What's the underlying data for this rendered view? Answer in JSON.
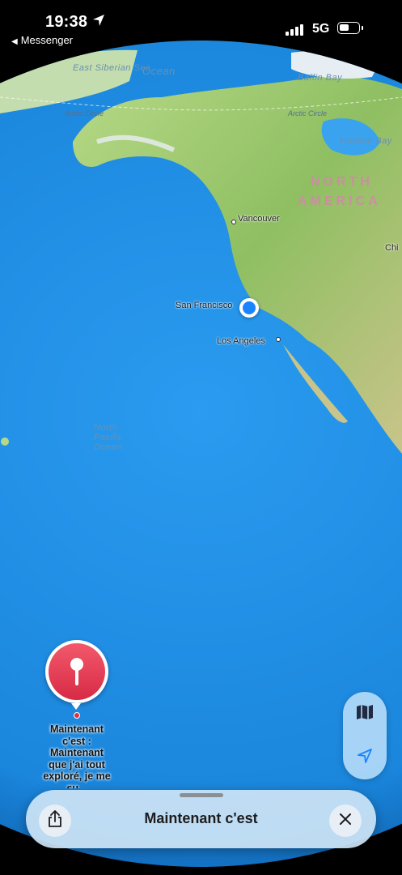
{
  "status_bar": {
    "time": "19:38",
    "back_label": "Messenger",
    "network": "5G",
    "location_icon": "location-arrow-icon",
    "battery_level": 0.4
  },
  "map": {
    "seas": [
      "East Siberian Sea",
      "Ocean",
      "Baffin Bay",
      "Hudson Bay",
      "North Pacific Ocean"
    ],
    "arctic_circle_label": "Arctic Circle",
    "region_label_line1": "NORTH",
    "region_label_line2": "AMERICA",
    "cities": [
      "Vancouver",
      "San Francisco",
      "Los Angeles",
      "Chi"
    ],
    "land_color": "#9ec96e",
    "ocean_color": "#1e8fe0"
  },
  "pin": {
    "label": "Maintenant c'est : Maintenant que j'ai tout exploré, je me su..."
  },
  "controls": {
    "map_icon": "map-icon",
    "location_icon": "location-arrow-icon"
  },
  "sheet": {
    "title": "Maintenant c'est",
    "share_icon": "share-icon",
    "close_icon": "close-icon"
  }
}
